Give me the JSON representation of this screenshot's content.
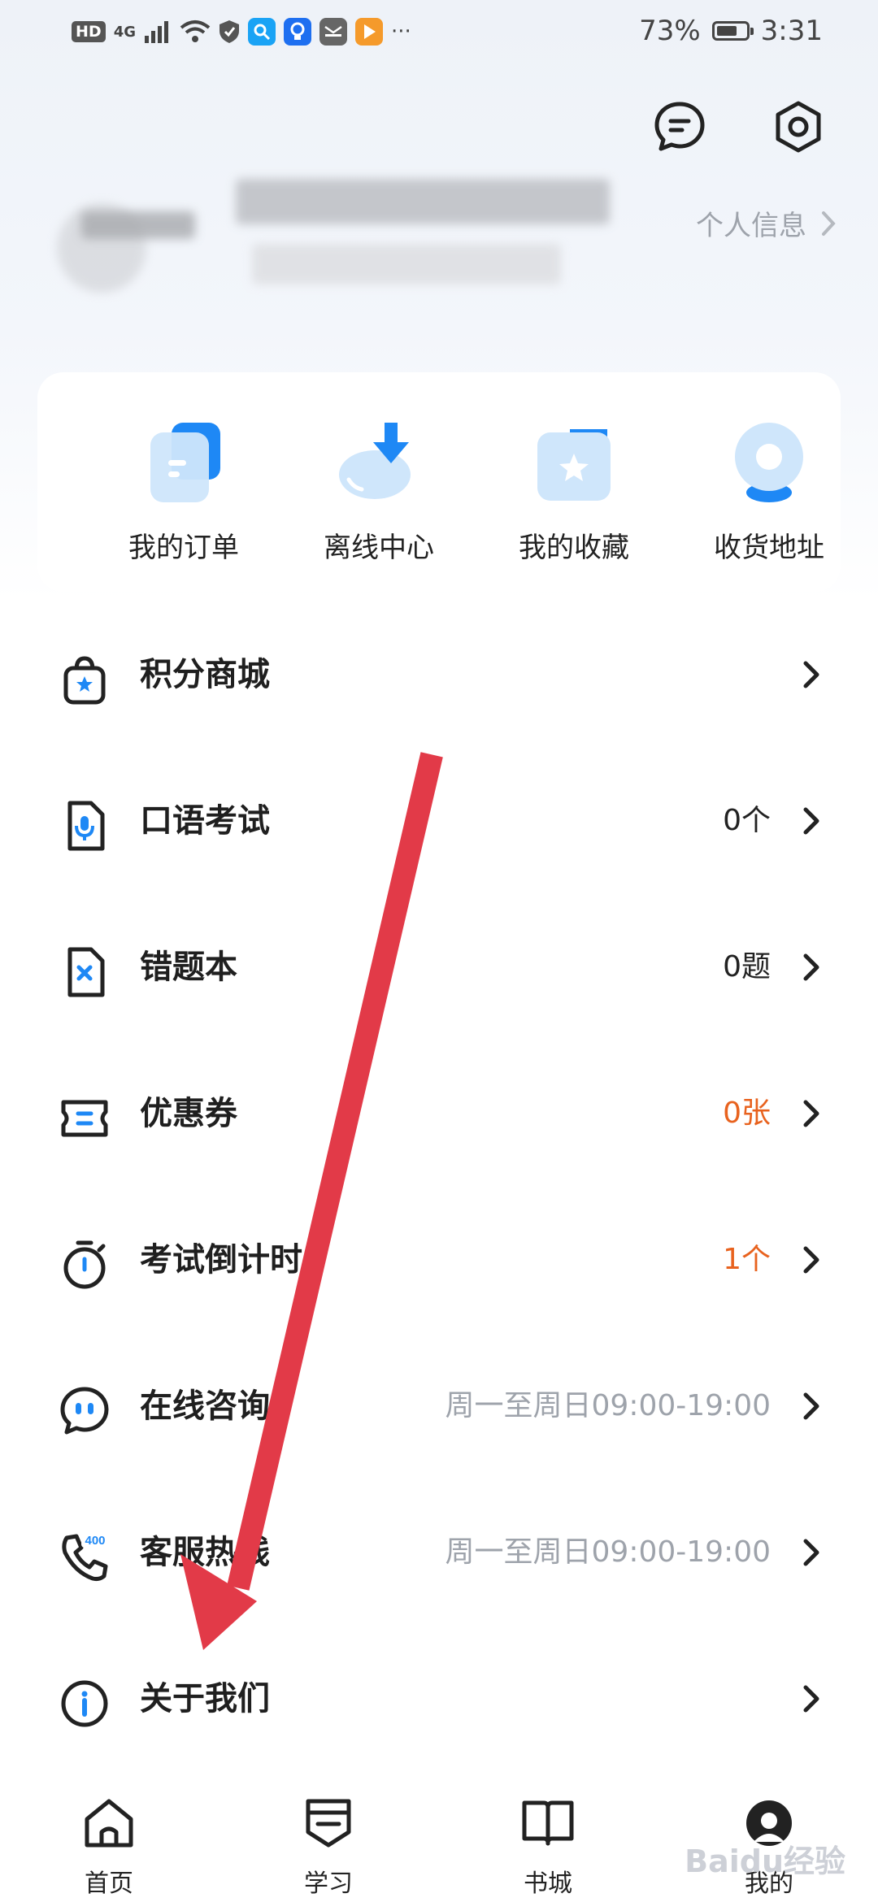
{
  "status_bar": {
    "hd": "HD",
    "network": "4G",
    "battery": "73%",
    "battery_level": 0.73,
    "time": "3:31",
    "more": "···"
  },
  "header": {
    "message_icon": "message-icon",
    "settings_icon": "settings-icon"
  },
  "profile": {
    "personal_info_label": "个人信息"
  },
  "quick_actions": [
    {
      "label": "我的订单",
      "icon": "order-icon"
    },
    {
      "label": "离线中心",
      "icon": "offline-download-icon"
    },
    {
      "label": "我的收藏",
      "icon": "favorites-folder-icon"
    },
    {
      "label": "收货地址",
      "icon": "location-pin-icon"
    }
  ],
  "menu": [
    {
      "label": "积分商城",
      "value": "",
      "value_style": "",
      "icon": "shopping-bag-icon"
    },
    {
      "label": "口语考试",
      "value": "0个",
      "value_style": "",
      "icon": "microphone-icon"
    },
    {
      "label": "错题本",
      "value": "0题",
      "value_style": "",
      "icon": "wrong-answers-book-icon"
    },
    {
      "label": "优惠券",
      "value": "0张",
      "value_style": "orange",
      "icon": "coupon-icon"
    },
    {
      "label": "考试倒计时",
      "value": "1个",
      "value_style": "orange",
      "icon": "stopwatch-icon"
    },
    {
      "label": "在线咨询",
      "value": "周一至周日09:00-19:00",
      "value_style": "grey",
      "icon": "chat-bubble-icon"
    },
    {
      "label": "客服热线",
      "value": "周一至周日09:00-19:00",
      "value_style": "grey",
      "icon": "phone-400-icon"
    },
    {
      "label": "关于我们",
      "value": "",
      "value_style": "",
      "icon": "info-icon"
    }
  ],
  "tabs": [
    {
      "label": "首页",
      "icon": "home-icon"
    },
    {
      "label": "学习",
      "icon": "study-icon"
    },
    {
      "label": "书城",
      "icon": "book-icon"
    },
    {
      "label": "我的",
      "icon": "profile-avatar-icon"
    }
  ],
  "colors": {
    "accent_blue": "#1e88f5",
    "orange": "#e8621e",
    "annotation_red": "#e23a48"
  },
  "watermark": "Baidu经验"
}
